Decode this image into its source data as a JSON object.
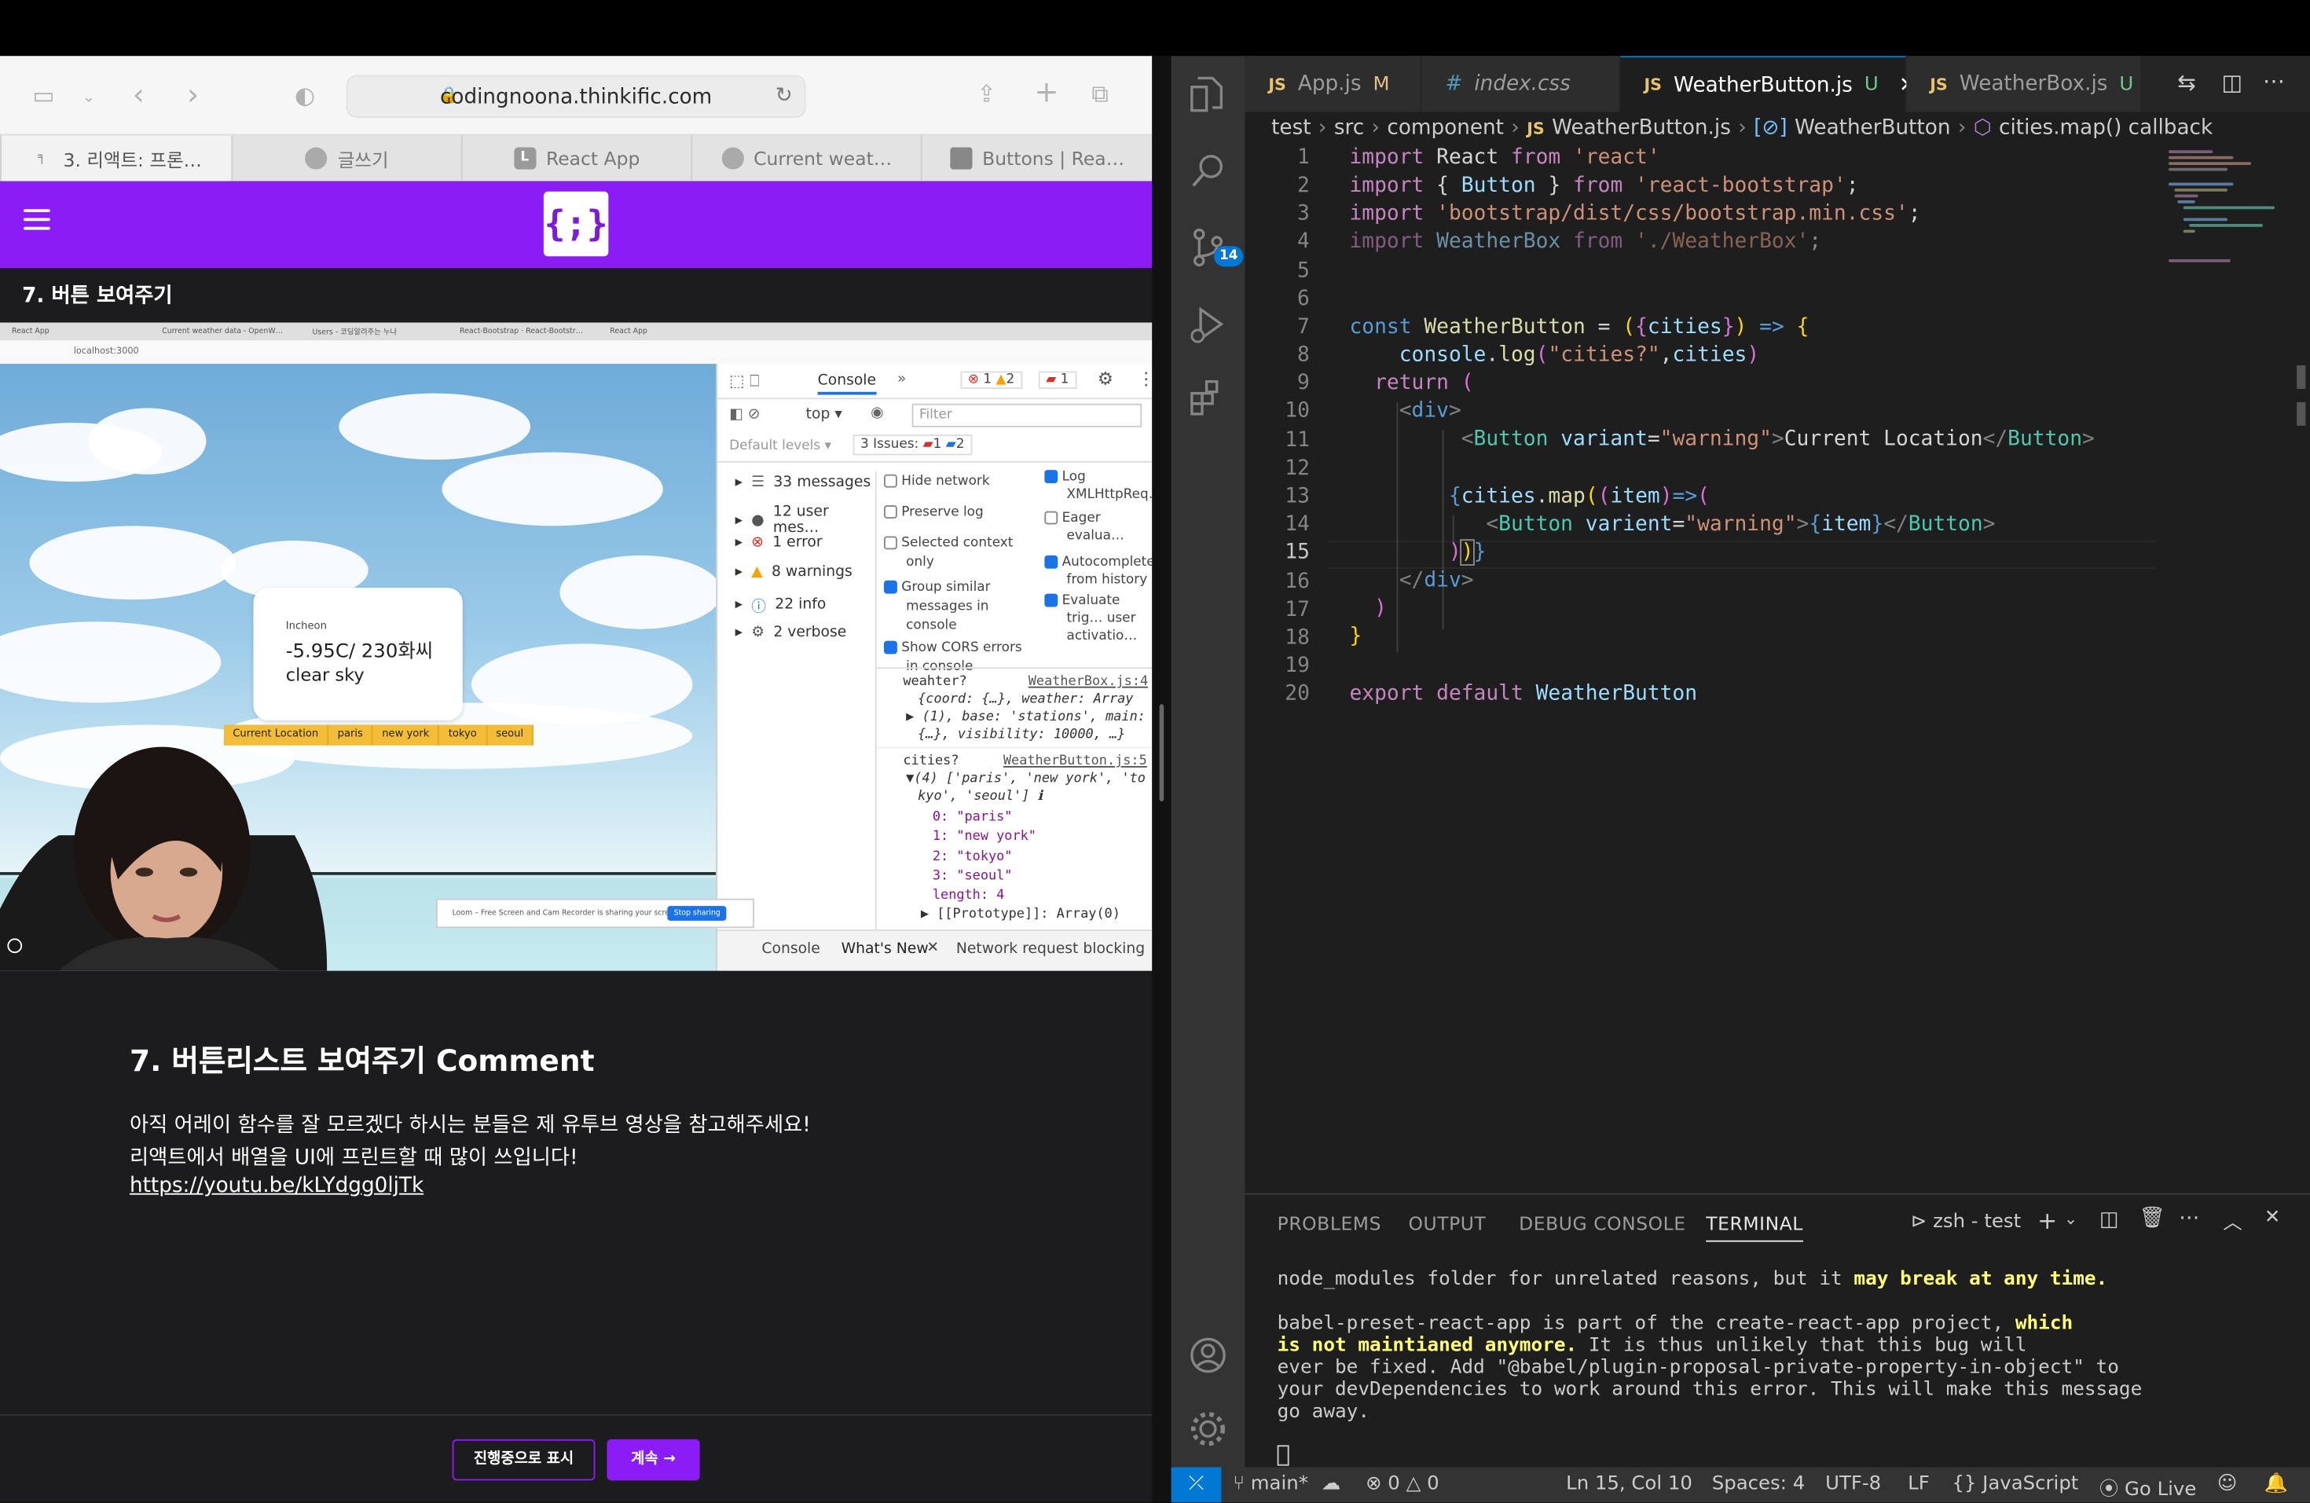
{
  "safari": {
    "url": "codingnoona.thinkific.com",
    "tabs": [
      "3. 리액트: 프론…",
      "글쓰기",
      "React App",
      "Current weat…",
      "Buttons | Rea…"
    ],
    "tab_favicons": [
      "",
      "",
      "L",
      "",
      ""
    ],
    "logo_text": "{;}",
    "lesson_title": "7. 버튼 보여주기",
    "video": {
      "tabs": [
        "React App",
        "Current weather data - OpenW…",
        "Users - 코딩알려주는 누나",
        "React-Bootstrap · React-Bootstr…",
        "React App"
      ],
      "address": "localhost:3000",
      "weather_city": "Incheon",
      "weather_temp": "-5.95C/ 230화씨",
      "weather_desc": "clear sky",
      "weather_buttons": [
        "Current Location",
        "paris",
        "new york",
        "tokyo",
        "seoul"
      ],
      "devtools": {
        "tab_console": "Console",
        "errors": "1",
        "warnings": "2",
        "issues_badge": "1",
        "context": "top",
        "filter_placeholder": "Filter",
        "default_levels": "Default levels",
        "issues_label": "3 Issues:",
        "issues_err": "1",
        "issues_info": "2",
        "sidebar": [
          "33 messages",
          "12 user mes…",
          "1 error",
          "8 warnings",
          "22 info",
          "2 verbose"
        ],
        "options_left": [
          "Hide network",
          "Preserve log",
          "Selected context only",
          "Group similar messages in console",
          "Show CORS errors in console"
        ],
        "options_right": [
          "Log XMLHttpReq…",
          "Eager evalua…",
          "Autocomplete from history",
          "Evaluate trig… user activatio…"
        ],
        "log1_label": "weahter?",
        "log1_src": "WeatherBox.js:4",
        "log1_lines": [
          "{coord: {…}, weather: Array",
          "▶ (1), base: 'stations', main:",
          "{…}, visibility: 10000, …}"
        ],
        "log2_label": "cities?",
        "log2_src": "WeatherButton.js:5",
        "log2_lines": [
          "▼(4) ['paris', 'new york', 'to",
          "kyo', 'seoul'] ℹ",
          "0: \"paris\"",
          "1: \"new york\"",
          "2: \"tokyo\"",
          "3: \"seoul\"",
          "length: 4",
          "▶ [[Prototype]]: Array(0)"
        ],
        "bottom_tabs": [
          "Console",
          "What's New",
          "Network request blocking"
        ]
      },
      "loom_text": "Loom – Free Screen and Cam Recorder is sharing your screen.",
      "loom_stop": "Stop sharing"
    },
    "comment_heading": "7. 버튼리스트 보여주기 Comment",
    "comment_line1": "아직 어레이 함수를 잘 모르겠다 하시는 분들은 제 유투브 영상을 참고해주세요!",
    "comment_line2": "리액트에서 배열을 UI에 프린트할 때 많이 쓰입니다!",
    "comment_link": "https://youtu.be/kLYdgg0ljTk",
    "btn_progress": "진행중으로 표시",
    "btn_continue": "계속 →"
  },
  "vscode": {
    "tabs": [
      {
        "icon": "JS",
        "name": "App.js",
        "flag": "M"
      },
      {
        "icon": "#",
        "name": "index.css",
        "flag": ""
      },
      {
        "icon": "JS",
        "name": "WeatherButton.js",
        "flag": "U"
      },
      {
        "icon": "JS",
        "name": "WeatherBox.js",
        "flag": "U"
      }
    ],
    "breadcrumb": [
      "test",
      "src",
      "component",
      "WeatherButton.js",
      "WeatherButton",
      "cities.map() callback"
    ],
    "scm_badge": "14",
    "current_line": "15",
    "line_numbers": [
      "1",
      "2",
      "3",
      "4",
      "5",
      "6",
      "7",
      "8",
      "9",
      "10",
      "11",
      "12",
      "13",
      "14",
      "15",
      "16",
      "17",
      "18",
      "19",
      "20"
    ],
    "panel_tabs": [
      "PROBLEMS",
      "OUTPUT",
      "DEBUG CONSOLE",
      "TERMINAL"
    ],
    "terminal_name": "zsh - test",
    "terminal": {
      "l1a": "node_modules folder for unrelated reasons, but it ",
      "l1b": "may break at any time.",
      "l2a": "babel-preset-react-app is part of the create-react-app project, ",
      "l2b": "which",
      "l3a": "is not maintianed anymore.",
      "l3b": " It is thus unlikely that this bug will",
      "l4": "ever be fixed. Add \"@babel/plugin-proposal-private-property-in-object\" to",
      "l5": "your devDependencies to work around this error. This will make this message",
      "l6": "go away."
    },
    "status": {
      "branch": "main*",
      "errors": "0",
      "warnings": "0",
      "position": "Ln 15, Col 10",
      "spaces": "Spaces: 4",
      "encoding": "UTF-8",
      "eol": "LF",
      "language": "JavaScript",
      "golive": "Go Live"
    }
  }
}
